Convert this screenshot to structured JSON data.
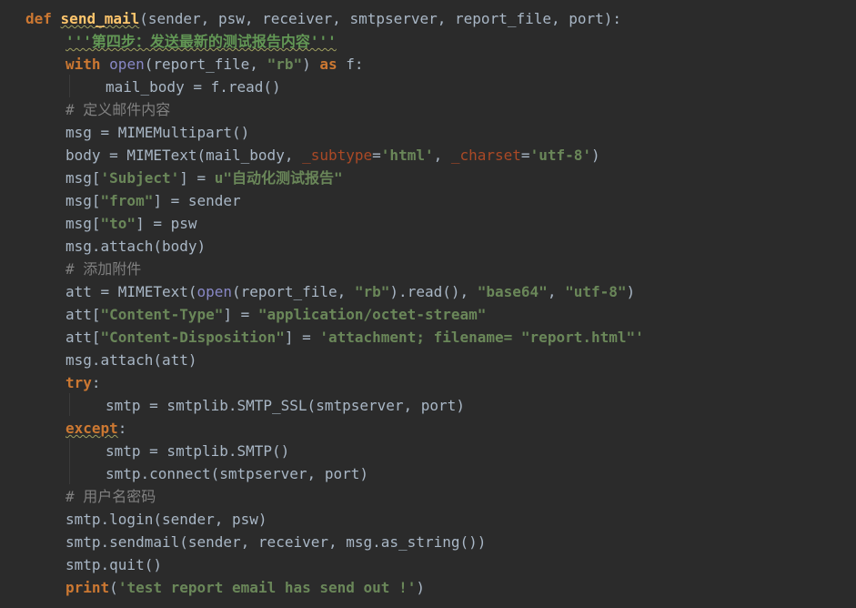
{
  "code": {
    "line1": {
      "def": "def",
      "fn_name": "send_mail",
      "params": "(sender, psw, receiver, smtpserver, report_file, port):"
    },
    "line2": {
      "doc": "'''第四步：发送最新的测试报告内容'''"
    },
    "line3": {
      "with": "with",
      "open": "open",
      "pre": "(report_file, ",
      "mode": "\"rb\"",
      "close": ")",
      "as": "as",
      "var": "f:"
    },
    "line4": {
      "text": "mail_body = f.read()"
    },
    "line5": {
      "comment": "# 定义邮件内容"
    },
    "line6": {
      "text": "msg = MIMEMultipart()"
    },
    "line7": {
      "pre": "body = MIMEText(mail_body, ",
      "k1": "_subtype",
      "eq1": "=",
      "v1": "'html'",
      "comma": ", ",
      "k2": "_charset",
      "eq2": "=",
      "v2": "'utf-8'",
      "close": ")"
    },
    "line8": {
      "pre": "msg[",
      "key": "'Subject'",
      "mid": "] = ",
      "val": "u\"自动化测试报告\""
    },
    "line9": {
      "pre": "msg[",
      "key": "\"from\"",
      "mid": "] = sender"
    },
    "line10": {
      "pre": "msg[",
      "key": "\"to\"",
      "mid": "] = psw"
    },
    "line11": {
      "text": "msg.attach(body)"
    },
    "line12": {
      "comment": "# 添加附件"
    },
    "line13": {
      "pre": "att = MIMEText(",
      "open": "open",
      "mid": "(report_file, ",
      "mode": "\"rb\"",
      "mid2": ").read(), ",
      "enc": "\"base64\"",
      "comma": ", ",
      "cs": "\"utf-8\"",
      "close": ")"
    },
    "line14": {
      "pre": "att[",
      "key": "\"Content-Type\"",
      "mid": "] = ",
      "val": "\"application/octet-stream\""
    },
    "line15": {
      "pre": "att[",
      "key": "\"Content-Disposition\"",
      "mid": "] = ",
      "val": "'attachment; filename= \"report.html\"'"
    },
    "line16": {
      "text": "msg.attach(att)"
    },
    "line17": {
      "kw": "try",
      "colon": ":"
    },
    "line18": {
      "text": "smtp = smtplib.SMTP_SSL(smtpserver, port)"
    },
    "line19": {
      "kw": "except",
      "colon": ":"
    },
    "line20": {
      "text": "smtp = smtplib.SMTP()"
    },
    "line21": {
      "text": "smtp.connect(smtpserver, port)"
    },
    "line22": {
      "comment": "# 用户名密码"
    },
    "line23": {
      "text": "smtp.login(sender, psw)"
    },
    "line24": {
      "text": "smtp.sendmail(sender, receiver, msg.as_string())"
    },
    "line25": {
      "text": "smtp.quit()"
    },
    "line26": {
      "print": "print",
      "open": "(",
      "msg": "'test report email has send out !'",
      "close": ")"
    }
  },
  "colors": {
    "background": "#2b2b2b",
    "keyword": "#cc7832",
    "function": "#ffc66d",
    "string": "#6a8759",
    "comment": "#808080",
    "builtin": "#8888c6",
    "default": "#a9b7c6"
  }
}
